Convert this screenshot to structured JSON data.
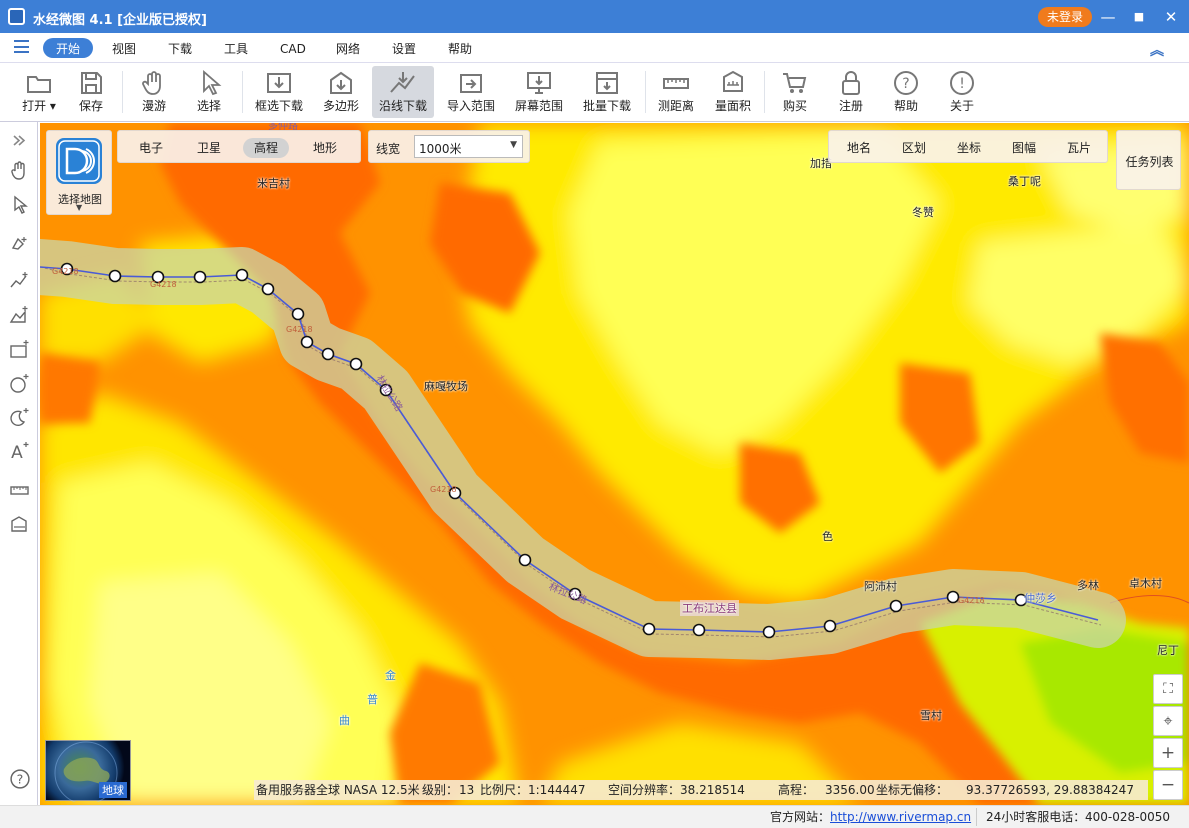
{
  "window": {
    "title": "水经微图 4.1 [企业版已授权]",
    "login_label": "未登录",
    "minimize": "—",
    "maximize": "■",
    "close": "✕"
  },
  "menu": {
    "items": [
      "开始",
      "视图",
      "下载",
      "工具",
      "CAD",
      "网络",
      "设置",
      "帮助"
    ],
    "active": "开始"
  },
  "toolbar": {
    "open": "打开",
    "save": "保存",
    "roam": "漫游",
    "select": "选择",
    "box_download": "框选下载",
    "polygon": "多边形",
    "line_download": "沿线下载",
    "import_range": "导入范围",
    "screen_range": "屏幕范围",
    "batch_download": "批量下载",
    "measure_distance": "测距离",
    "measure_area": "量面积",
    "buy": "购买",
    "register": "注册",
    "help": "帮助",
    "about": "关于"
  },
  "map_panel": {
    "select_map_label": "选择地图",
    "map_types": [
      "电子",
      "卫星",
      "高程",
      "地形"
    ],
    "active_map_type": "高程",
    "line_width_label": "线宽",
    "line_width_value": "1000米",
    "overlays": [
      "地名",
      "区划",
      "坐标",
      "图幅",
      "瓦片"
    ],
    "task_list": "任务列表",
    "globe_label": "地球"
  },
  "map_labels": {
    "mijicun": "米吉村",
    "jiaxi": "加措",
    "sangdingni": "桑丁呢",
    "dongzan": "冬赞",
    "magamuchang": "麻嘎牧场",
    "se": "色",
    "apucun": "阿沛村",
    "gongbujiangda": "工布江达县",
    "duolin": "多林",
    "zhuomucun": "卓木村",
    "niding": "尼丁",
    "jin": "金",
    "pu": "普",
    "qu": "曲",
    "xuecun": "雪村",
    "zhongshaxiang": "仲莎乡",
    "road_g4218": "G4218",
    "road_linla": "林拉公路",
    "road_top": "多仲路"
  },
  "status": {
    "server": "备用服务器全球 NASA 12.5米",
    "level_label": "级别：",
    "level": "13",
    "scale_label": "比例尺：",
    "scale": "1:144447",
    "resolution_label": "空间分辨率：",
    "resolution": "38.218514",
    "elevation_label": "高程：",
    "elevation": "3356.00",
    "coord_label": "坐标无偏移：",
    "coordinates": "93.37726593, 29.88384247"
  },
  "footer": {
    "website_label": "官方网站：",
    "website": "http://www.rivermap.cn",
    "hotline_label": "24小时客服电话：",
    "hotline": "400-028-0050"
  },
  "colors": {
    "titlebar": "#3d7fd6",
    "accent": "#3d7fd6",
    "login": "#f07b1d",
    "route_line": "#4a5bd6",
    "terrain_high": "#ffff66",
    "terrain_mid": "#ffa500",
    "terrain_low": "#ff5a00"
  }
}
